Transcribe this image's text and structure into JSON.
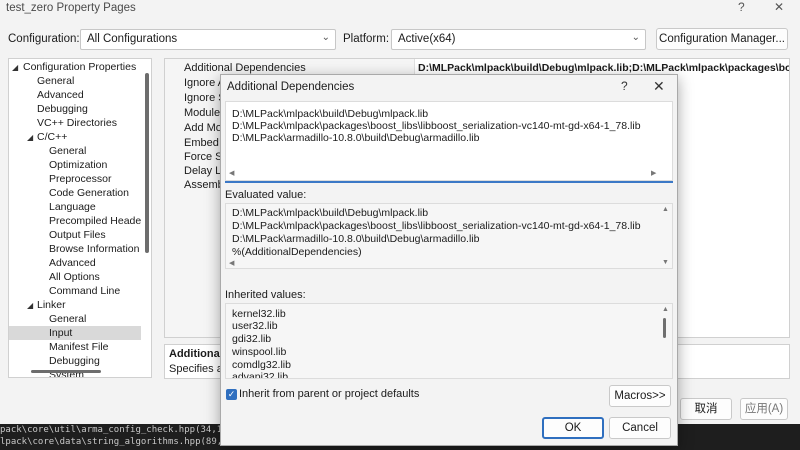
{
  "window": {
    "title": "test_zero Property Pages",
    "help_symbol": "?",
    "close_symbol": "✕"
  },
  "config_row": {
    "configuration_label": "Configuration:",
    "configuration_value": "All Configurations",
    "platform_label": "Platform:",
    "platform_value": "Active(x64)",
    "config_manager_label": "Configuration Manager..."
  },
  "tree": {
    "items": [
      {
        "label": "Configuration Properties",
        "expander": "◢"
      },
      {
        "label": "General"
      },
      {
        "label": "Advanced"
      },
      {
        "label": "Debugging"
      },
      {
        "label": "VC++ Directories"
      },
      {
        "label": "C/C++",
        "expander": "◢"
      },
      {
        "label": "General"
      },
      {
        "label": "Optimization"
      },
      {
        "label": "Preprocessor"
      },
      {
        "label": "Code Generation"
      },
      {
        "label": "Language"
      },
      {
        "label": "Precompiled Heade"
      },
      {
        "label": "Output Files"
      },
      {
        "label": "Browse Information"
      },
      {
        "label": "Advanced"
      },
      {
        "label": "All Options"
      },
      {
        "label": "Command Line"
      },
      {
        "label": "Linker",
        "expander": "◢"
      },
      {
        "label": "General"
      },
      {
        "label": "Input",
        "selected": true
      },
      {
        "label": "Manifest File"
      },
      {
        "label": "Debugging"
      },
      {
        "label": "System"
      }
    ]
  },
  "grid": {
    "rows": [
      {
        "name": "Additional Dependencies",
        "value": "D:\\MLPack\\mlpack\\build\\Debug\\mlpack.lib;D:\\MLPack\\mlpack\\packages\\boo"
      },
      {
        "name": "Ignore A",
        "value": ""
      },
      {
        "name": "Ignore S",
        "value": ""
      },
      {
        "name": "Module",
        "value": ""
      },
      {
        "name": "Add Mo",
        "value": ""
      },
      {
        "name": "Embed M",
        "value": ""
      },
      {
        "name": "Force Sy",
        "value": ""
      },
      {
        "name": "Delay Lo",
        "value": ""
      },
      {
        "name": "Assemb",
        "value": ""
      }
    ]
  },
  "description": {
    "title": "Additional",
    "text": "Specifies ad"
  },
  "footer": {
    "cancel_label": "取消",
    "apply_label": "应用(A)"
  },
  "console": {
    "lines": [
      "pack\\core\\util\\arma_config_check.hpp(34,1):",
      "lpack\\core\\data\\string_algorithms.hpp(89,3):"
    ]
  },
  "dialog": {
    "title": "Additional Dependencies",
    "help_symbol": "?",
    "close_symbol": "✕",
    "edit_lines": [
      "D:\\MLPack\\mlpack\\build\\Debug\\mlpack.lib",
      "D:\\MLPack\\mlpack\\packages\\boost_libs\\libboost_serialization-vc140-mt-gd-x64-1_78.lib",
      "D:\\MLPack\\armadillo-10.8.0\\build\\Debug\\armadillo.lib"
    ],
    "evaluated_label": "Evaluated value:",
    "evaluated_lines": [
      "D:\\MLPack\\mlpack\\build\\Debug\\mlpack.lib",
      "D:\\MLPack\\mlpack\\packages\\boost_libs\\libboost_serialization-vc140-mt-gd-x64-1_78.lib",
      "D:\\MLPack\\armadillo-10.8.0\\build\\Debug\\armadillo.lib",
      "%(AdditionalDependencies)"
    ],
    "inherited_label": "Inherited values:",
    "inherited_lines": [
      "kernel32.lib",
      "user32.lib",
      "gdi32.lib",
      "winspool.lib",
      "comdlg32.lib",
      "advapi32.lib"
    ],
    "inherit_checkbox_label": "Inherit from parent or project defaults",
    "inherit_checked": true,
    "macros_label": "Macros>>",
    "ok_label": "OK",
    "cancel_label": "Cancel"
  },
  "colors": {
    "accent": "#2f6fbf",
    "selection": "#d9d9d9"
  }
}
